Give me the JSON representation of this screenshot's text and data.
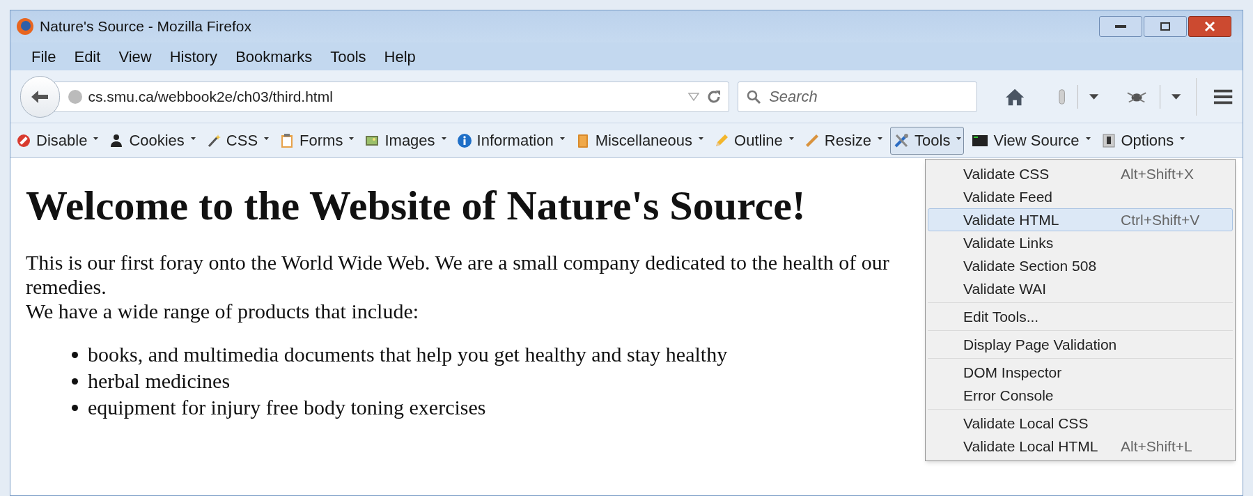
{
  "window": {
    "title": "Nature's Source - Mozilla Firefox"
  },
  "menu_bar": [
    "File",
    "Edit",
    "View",
    "History",
    "Bookmarks",
    "Tools",
    "Help"
  ],
  "nav_bar": {
    "url": "cs.smu.ca/webbook2e/ch03/third.html",
    "search": {
      "placeholder": "Search"
    }
  },
  "dev_toolbar": [
    {
      "label": "Disable",
      "selected": false
    },
    {
      "label": "Cookies",
      "selected": false
    },
    {
      "label": "CSS",
      "selected": false
    },
    {
      "label": "Forms",
      "selected": false
    },
    {
      "label": "Images",
      "selected": false
    },
    {
      "label": "Information",
      "selected": false
    },
    {
      "label": "Miscellaneous",
      "selected": false
    },
    {
      "label": "Outline",
      "selected": false
    },
    {
      "label": "Resize",
      "selected": false
    },
    {
      "label": "Tools",
      "selected": true
    },
    {
      "label": "View Source",
      "selected": false
    },
    {
      "label": "Options",
      "selected": false
    }
  ],
  "page": {
    "heading": "Welcome to the Website of Nature's Source!",
    "paragraph": "This is our first foray onto the World Wide Web. We are a small company dedicated to the health of our",
    "paragraph_continued": "remedies.",
    "intro": "We have a wide range of products that include:",
    "list": [
      "books, and multimedia documents that help you get healthy and stay healthy",
      "herbal medicines",
      "equipment for injury free body toning exercises"
    ]
  },
  "tools_menu": [
    [
      {
        "label": "Validate CSS",
        "shortcut": "Alt+Shift+X",
        "selected": false
      },
      {
        "label": "Validate Feed",
        "selected": false
      },
      {
        "label": "Validate HTML",
        "shortcut": "Ctrl+Shift+V",
        "selected": true
      },
      {
        "label": "Validate Links",
        "selected": false
      },
      {
        "label": "Validate Section 508",
        "selected": false
      },
      {
        "label": "Validate WAI",
        "selected": false
      }
    ],
    [
      {
        "label": "Edit Tools...",
        "selected": false
      }
    ],
    [
      {
        "label": "Display Page Validation",
        "selected": false
      }
    ],
    [
      {
        "label": "DOM Inspector",
        "selected": false
      },
      {
        "label": "Error Console",
        "selected": false
      }
    ],
    [
      {
        "label": "Validate Local CSS",
        "selected": false
      },
      {
        "label": "Validate Local HTML",
        "shortcut": "Alt+Shift+L",
        "selected": false
      }
    ]
  ]
}
